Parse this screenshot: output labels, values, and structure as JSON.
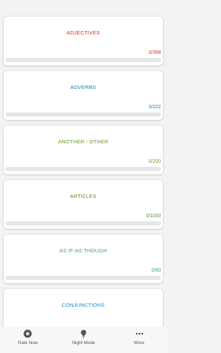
{
  "categories": [
    {
      "title": "ADJECTIVES",
      "count": "0/368",
      "progress": 0,
      "color": "#d32f2f"
    },
    {
      "title": "ADVERBS",
      "count": "0/222",
      "progress": 0,
      "color": "#1e7ca3"
    },
    {
      "title": "ANOTHER - OTHER",
      "count": "0/200",
      "progress": 0,
      "color": "#6e9b2c"
    },
    {
      "title": "ARTICLES",
      "count": "0/1033",
      "progress": 0,
      "color": "#5a8c2e"
    },
    {
      "title": "AS IF-AS THOUGH",
      "count": "0/60",
      "progress": 0,
      "color": "#3aa872"
    },
    {
      "title": "CONJUNCTIONS",
      "count": "",
      "progress": 0,
      "color": "#1a8fc2"
    }
  ],
  "nav": {
    "rate_label": "Rate Now",
    "rate_icon": "star-badge-icon",
    "night_label": "Night Mode",
    "night_icon": "lightbulb-icon",
    "more_label": "More",
    "more_icon": "more-dots-icon"
  }
}
